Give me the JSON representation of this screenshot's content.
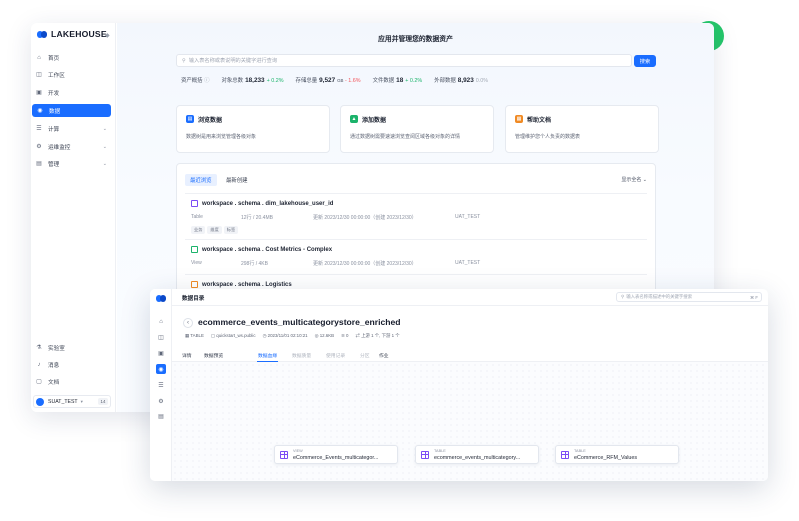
{
  "back": {
    "brand": "LAKEHOUSE",
    "nav": [
      {
        "label": "首页",
        "icon": "home-icon"
      },
      {
        "label": "工作区",
        "icon": "workspace-icon"
      },
      {
        "label": "开发",
        "icon": "code-icon"
      },
      {
        "label": "数据",
        "icon": "database-icon",
        "active": true
      },
      {
        "label": "计算",
        "icon": "compute-icon",
        "chevron": true
      },
      {
        "label": "运维监控",
        "icon": "monitor-icon",
        "chevron": true
      },
      {
        "label": "管理",
        "icon": "manage-icon",
        "chevron": true
      }
    ],
    "bottom_nav": [
      {
        "label": "实验室",
        "icon": "lab-icon"
      },
      {
        "label": "消息",
        "icon": "bell-icon"
      },
      {
        "label": "文档",
        "icon": "book-icon"
      }
    ],
    "user": {
      "name": "SUAT_TEST",
      "badge": "14"
    },
    "hero_title": "应用并管理您的数据资产",
    "search_placeholder": "输入表名称或表说明的关键字进行查询",
    "search_button": "搜索",
    "stats": {
      "label": "资产概括",
      "items": [
        {
          "label": "对象总数",
          "value": "18,233",
          "delta": "+ 0.2%",
          "dir": "up"
        },
        {
          "label": "存储总量",
          "value": "9,527",
          "unit": "GB",
          "delta": "- 1.6%",
          "dir": "down"
        },
        {
          "label": "文件数据",
          "value": "18",
          "delta": "+ 0.2%",
          "dir": "up"
        },
        {
          "label": "外部数据",
          "value": "8,923",
          "delta": "0.0%",
          "dir": "flat"
        }
      ]
    },
    "cards": [
      {
        "title": "浏览数据",
        "desc": "数据树是用来浏览管理各级对象",
        "color": "#1a6dff"
      },
      {
        "title": "添加数据",
        "desc": "通过数据树需要速速浏览查阅区域各级对象的详情",
        "color": "#1bb36b"
      },
      {
        "title": "帮助文档",
        "desc": "管理维护您个人负责的数据表",
        "color": "#f08a24"
      }
    ],
    "recent": {
      "tabs": [
        "最近浏览",
        "最新创建"
      ],
      "show_all": "显示全名",
      "rows": [
        {
          "name": "workspace . schema . dim_lakehouse_user_id",
          "type": "Table",
          "size": "12行 / 20.4MB",
          "time": "更新 2023/12/30 00:00:00（创建 2023/12/30）",
          "owner": "UAT_TEST",
          "tags": [
            "业务",
            "维度",
            "标签"
          ],
          "color": "#7b4cf5"
        },
        {
          "name": "workspace . schema . Cost Metrics - Complex",
          "type": "View",
          "size": "298行 / 4KB",
          "time": "更新 2023/12/30 00:00:00（创建 2023/12/30）",
          "owner": "UAT_TEST",
          "tags": [],
          "color": "#1bb36b"
        },
        {
          "name": "workspace . schema . Logistics",
          "type": "",
          "size": "",
          "time": "",
          "owner": "",
          "tags": [],
          "color": "#f08a24"
        }
      ]
    }
  },
  "front": {
    "top_title": "数据目录",
    "search_placeholder": "输入表名称或描述中的关键字搜索",
    "kbd": "⌘ F",
    "title": "ecommerce_events_multicategorystore_enriched",
    "meta": [
      "TABLE",
      "quickstart_ws.public",
      "2023/11/01 02:10:21",
      "12.6KB",
      "0",
      "上游 1 个, 下游 1 个"
    ],
    "tabs": [
      {
        "label": "详情",
        "state": "normal"
      },
      {
        "label": "数据预览",
        "state": "normal"
      },
      {
        "label": "数据血缘",
        "state": "active"
      },
      {
        "label": "数据质量",
        "state": "dim"
      },
      {
        "label": "使用记录",
        "state": "dim"
      },
      {
        "label": "分区",
        "state": "dim"
      },
      {
        "label": "作业",
        "state": "normal"
      }
    ],
    "nodes": [
      {
        "type": "VIEW",
        "name": "eCommerce_Events_multicategor..."
      },
      {
        "type": "TABLE",
        "name": "ecommerce_events_multicategory..."
      },
      {
        "type": "TABLE",
        "name": "eCommerce_RFM_Values"
      }
    ]
  }
}
